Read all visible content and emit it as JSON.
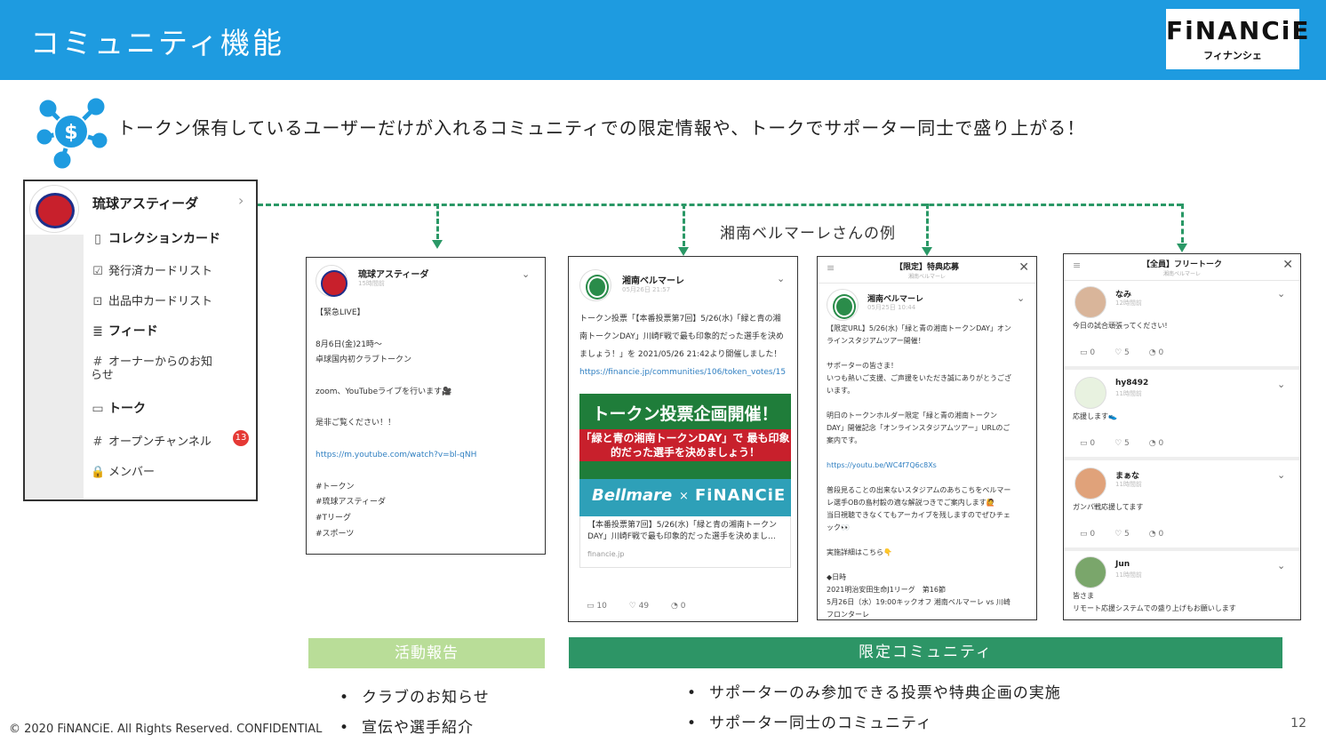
{
  "header": {
    "title": "コミュニティ機能",
    "logo": "FiNANCiE",
    "logo_sub": "フィナンシェ",
    "bg": "#1e9be0"
  },
  "lead": "トークン保有しているユーザーだけが入れるコミュニティでの限定情報や、トークでサポーター同士で盛り上がる！",
  "example_label": "湘南ベルマーレさんの例",
  "sidebar": {
    "club": "琉球アスティーダ",
    "items": [
      {
        "label": "コレクションカード",
        "icon": "card-icon"
      },
      {
        "label": "発行済カードリスト",
        "icon": "checkbox-icon"
      },
      {
        "label": "出品中カードリスト",
        "icon": "listing-icon"
      },
      {
        "label": "フィード",
        "icon": "feed-icon"
      },
      {
        "label": "オーナーからのお知らせ",
        "icon": "hash-icon"
      },
      {
        "label": "トーク",
        "icon": "talk-icon"
      },
      {
        "label": "オープンチャンネル",
        "icon": "hash-icon"
      },
      {
        "label": "メンバー",
        "icon": "lock-icon"
      }
    ],
    "badge": "13"
  },
  "post1": {
    "name": "琉球アスティーダ",
    "time": "15時間前",
    "lines": [
      "【緊急LIVE】",
      "8月6日(金)21時〜",
      "卓球国内初クラブトークン",
      "zoom、YouTubeライブを行います🎥",
      "是非ご覧ください！！"
    ],
    "url": "https://m.youtube.com/watch?v=bl-qNH",
    "tags": [
      "#トークン",
      "#琉球アスティーダ",
      "#Tリーグ",
      "#スポーツ"
    ]
  },
  "post2": {
    "name": "湘南ベルマーレ",
    "time": "05月26日 21:57",
    "lines": [
      "トークン投票「【本番投票第7回】5/26(水)「緑と青の湘",
      "南トークンDAY」川崎F戦で最も印象的だった選手を決め",
      "ましょう！」を 2021/05/26 21:42より開催しました！"
    ],
    "url": "https://financie.jp/communities/106/token_votes/15",
    "banner_title": "トークン投票企画開催！",
    "banner_sub": "「緑と青の湘南トークンDAY」で 最も印象的だった選手を決めましょう！",
    "banner_brand1": "Bellmare",
    "banner_x": "×",
    "banner_brand2": "FiNANCiE",
    "ogp_text": "【本番投票第7回】5/26(水)「緑と青の湘南トークン DAY」川崎F戦で最も印象的だった選手を決めまし…",
    "ogp_domain": "financie.jp",
    "comments": "10",
    "likes": "49",
    "tips": "0"
  },
  "post3": {
    "head": "【限定】特典応募",
    "head_sub": "湘南ベルマーレ",
    "name": "湘南ベルマーレ",
    "time": "05月25日 10:44",
    "lines": [
      "【限定URL】5/26(水)「緑と青の湘南トークンDAY」オン",
      "ラインスタジアムツアー開催！",
      "",
      "サポーターの皆さま！",
      "いつも熱いご支援、ご声援をいただき誠にありがとうござ",
      "います。",
      "",
      "明日のトークンホルダー限定「緑と青の湘南トークン",
      "DAY」開催記念「オンラインスタジアムツアー」URLのご",
      "案内です。"
    ],
    "url": "https://youtu.be/WC4f7Q6c8Xs",
    "lines2": [
      "普段見ることの出来ないスタジアムのあちこちをベルマー",
      "レ選手OBの島村毅の適な解説つきでご案内します🙋",
      "当日視聴できなくてもアーカイブを残しますのでぜひチェ",
      "ック👀",
      "",
      "実施詳細はこちら👇",
      "",
      "◆日時",
      "2021明治安田生命J1リーグ　第16節",
      "5月26日（水）19:00キックオフ 湘南ベルマーレ vs 川崎",
      "フロンターレ"
    ]
  },
  "post4": {
    "head": "【全員】フリートーク",
    "head_sub": "湘南ベルマーレ",
    "messages": [
      {
        "name": "なみ",
        "time": "12時間前",
        "text": "今日の試合頑張ってください!",
        "c": "0",
        "l": "5",
        "t": "0"
      },
      {
        "name": "hy8492",
        "time": "11時間前",
        "text": "応援します👟",
        "c": "0",
        "l": "5",
        "t": "0"
      },
      {
        "name": "まぁな",
        "time": "11時間前",
        "text": "ガンバ戦応援してます",
        "c": "0",
        "l": "5",
        "t": "0"
      },
      {
        "name": "Jun",
        "time": "11時間前",
        "text": "皆さま",
        "text2": "リモート応援システムでの盛り上げもお願いします"
      }
    ]
  },
  "labels": {
    "activity": "活動報告",
    "limited": "限定コミュニティ"
  },
  "bullets_left": [
    "クラブのお知らせ",
    "宣伝や選手紹介"
  ],
  "bullets_right": [
    "サポーターのみ参加できる投票や特典企画の実施",
    "サポーター同士のコミュニティ"
  ],
  "footer": "© 2020 FiNANCiE. All Rights Reserved. CONFIDENTIAL",
  "page_number": "12",
  "colors": {
    "accent_green": "#2d9566",
    "light_green": "#b9dd98",
    "header_blue": "#1e9be0",
    "badge_red": "#e53935"
  }
}
